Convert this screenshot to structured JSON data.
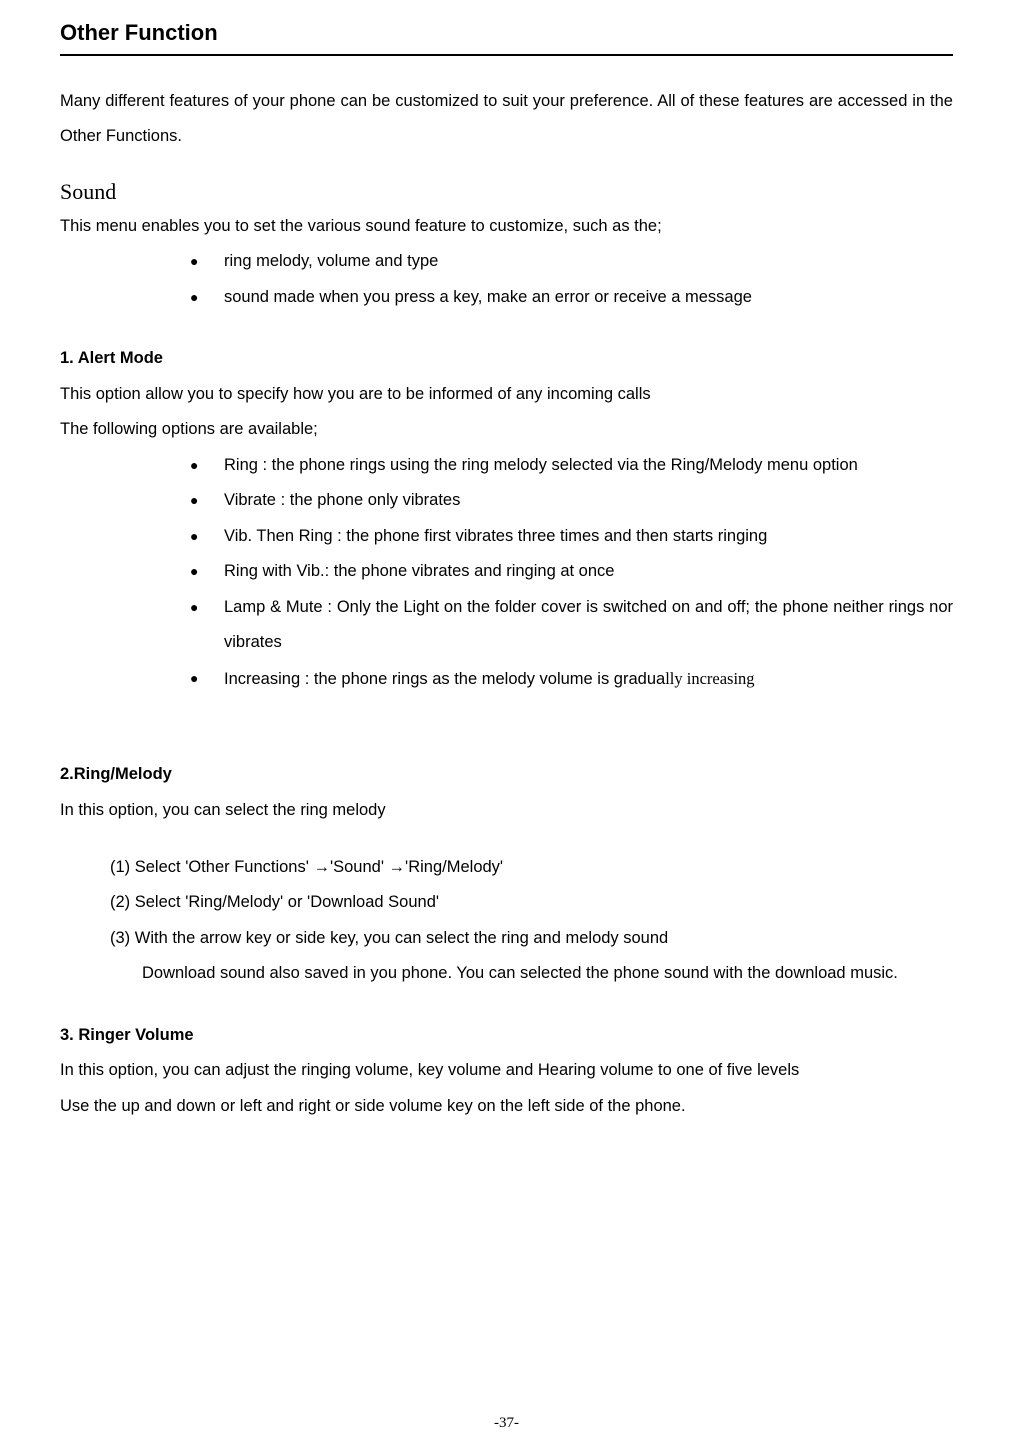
{
  "title": "Other Function",
  "intro": "Many different features of your phone can be customized to suit your preference. All of these features are accessed in the Other Functions.",
  "sound": {
    "heading": "Sound",
    "intro": "This menu enables you to set the various sound feature to customize, such as the;",
    "bullets": [
      "ring melody, volume and type",
      "sound made when you press a key, make an error or receive a message"
    ]
  },
  "alert_mode": {
    "heading": "1. Alert Mode",
    "line1": "This option allow you to specify how you are to be informed of any incoming calls",
    "line2": "The following options are available;",
    "bullets": [
      "Ring : the phone rings using the ring melody selected via the Ring/Melody menu option",
      "Vibrate : the phone only vibrates",
      "Vib. Then Ring : the phone first vibrates three times and then starts ringing",
      "Ring with Vib.: the phone vibrates and ringing at once",
      "Lamp & Mute : Only the Light on the folder cover is switched on and off; the phone neither rings nor vibrates"
    ],
    "last_bullet_prefix": "Increasing : the phone rings as the melody volume is gradua",
    "last_bullet_suffix": "lly increasing"
  },
  "ring_melody": {
    "heading": "2.Ring/Melody",
    "intro": "In this option, you can select the ring melody",
    "steps": [
      "(1) Select 'Other Functions' →'Sound' →'Ring/Melody'",
      "(2) Select 'Ring/Melody' or 'Download Sound'",
      "(3) With the arrow key or side key, you can select the ring and melody sound"
    ],
    "note": "Download sound also saved in you phone. You can selected the phone sound with the download music."
  },
  "ringer_volume": {
    "heading": "3. Ringer Volume",
    "line1": "In this option, you can adjust the ringing volume, key volume and Hearing volume to one of five levels",
    "line2": "Use the up and down or left and right or side volume key on the left side of the phone."
  },
  "page_number": "-37-"
}
